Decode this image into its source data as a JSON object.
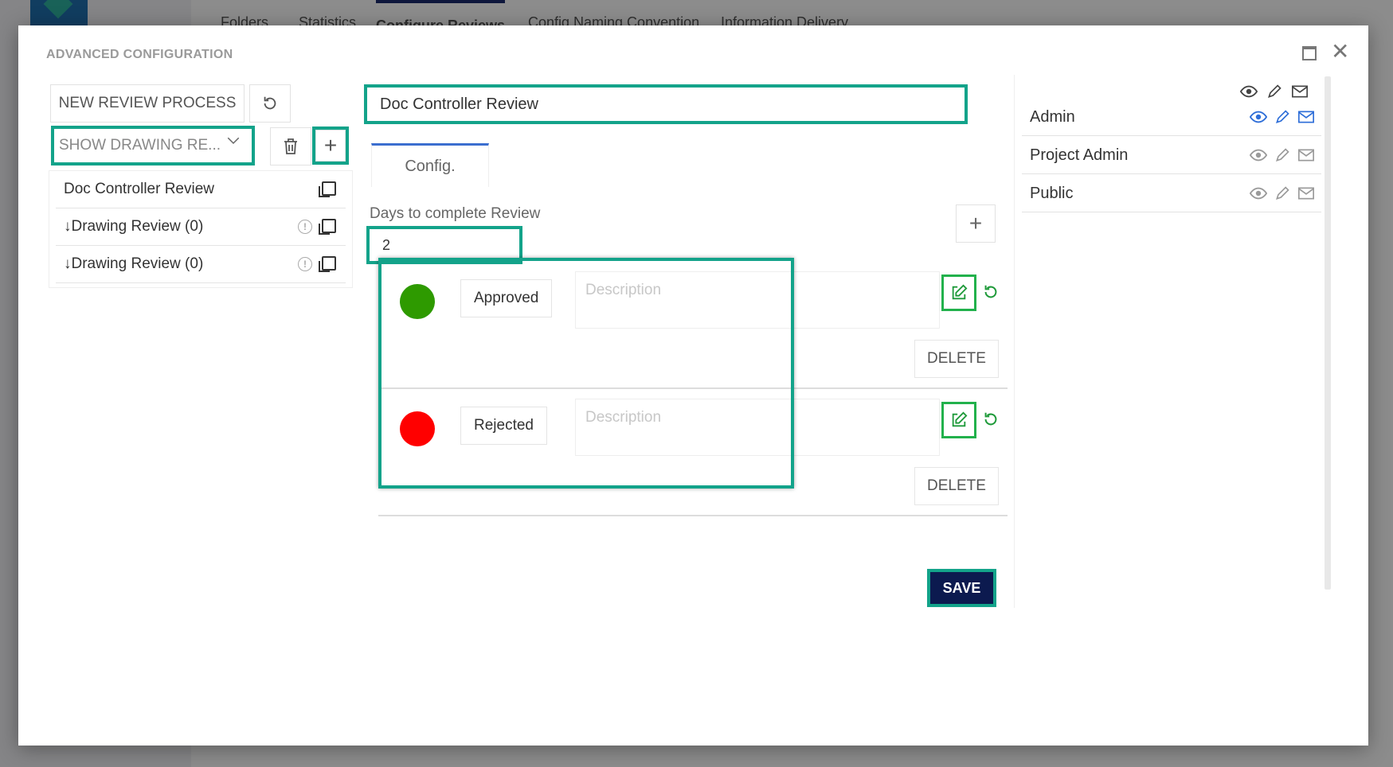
{
  "background_tabs": [
    "Folders",
    "Statistics",
    "Configure Reviews",
    "Config Naming Convention",
    "Information Delivery"
  ],
  "modal": {
    "title": "ADVANCED CONFIGURATION"
  },
  "left": {
    "new_review_label": "NEW REVIEW PROCESS",
    "select_value": "SHOW DRAWING RE...",
    "items": [
      {
        "label": "Doc Controller Review",
        "arrow": ""
      },
      {
        "label": "Drawing Review (0)",
        "arrow": "↓"
      },
      {
        "label": "Drawing Review (0)",
        "arrow": "↓"
      }
    ]
  },
  "middle": {
    "review_name": "Doc Controller Review",
    "tab_label": "Config.",
    "days_label": "Days to complete Review",
    "days_value": "2",
    "statuses": [
      {
        "name": "Approved",
        "color": "#2e9a00",
        "description_placeholder": "Description",
        "delete_label": "DELETE"
      },
      {
        "name": "Rejected",
        "color": "#ff0000",
        "description_placeholder": "Description",
        "delete_label": "DELETE"
      }
    ],
    "save_label": "SAVE"
  },
  "right": {
    "roles": [
      {
        "name": "Admin",
        "active": true
      },
      {
        "name": "Project Admin",
        "active": false
      },
      {
        "name": "Public",
        "active": false
      }
    ]
  },
  "colors": {
    "highlight": "#13a38a",
    "active_icon": "#2e6ed8",
    "inactive_icon": "#9a9a9a",
    "save_bg": "#0c1a4f"
  }
}
